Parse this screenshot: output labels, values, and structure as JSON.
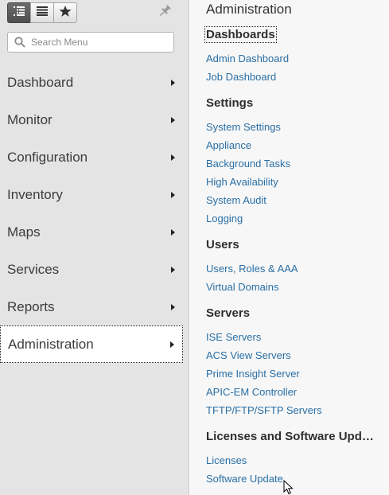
{
  "toolbar": {
    "buttons": [
      {
        "icon": "tree-list-icon",
        "active": true
      },
      {
        "icon": "list-icon",
        "active": false
      },
      {
        "icon": "star-icon",
        "active": false
      }
    ],
    "pin_icon": "pin-icon"
  },
  "search": {
    "placeholder": "Search Menu"
  },
  "nav": {
    "items": [
      {
        "label": "Dashboard"
      },
      {
        "label": "Monitor"
      },
      {
        "label": "Configuration"
      },
      {
        "label": "Inventory"
      },
      {
        "label": "Maps"
      },
      {
        "label": "Services"
      },
      {
        "label": "Reports"
      },
      {
        "label": "Administration",
        "selected": true
      }
    ]
  },
  "content": {
    "title": "Administration",
    "sections": [
      {
        "heading": "Dashboards",
        "links": [
          "Admin Dashboard",
          "Job Dashboard"
        ]
      },
      {
        "heading": "Settings",
        "links": [
          "System Settings",
          "Appliance",
          "Background Tasks",
          "High Availability",
          "System Audit",
          "Logging"
        ]
      },
      {
        "heading": "Users",
        "links": [
          "Users, Roles & AAA",
          "Virtual Domains"
        ]
      },
      {
        "heading": "Servers",
        "links": [
          "ISE Servers",
          "ACS View Servers",
          "Prime Insight Server",
          "APIC-EM Controller",
          "TFTP/FTP/SFTP Servers"
        ]
      },
      {
        "heading": "Licenses and Software Upd…",
        "links": [
          "Licenses",
          "Software Update"
        ]
      }
    ]
  },
  "colors": {
    "link": "#2a6fa5",
    "sidebar_bg": "#e4e4e4",
    "content_bg": "#f7f7f7"
  }
}
